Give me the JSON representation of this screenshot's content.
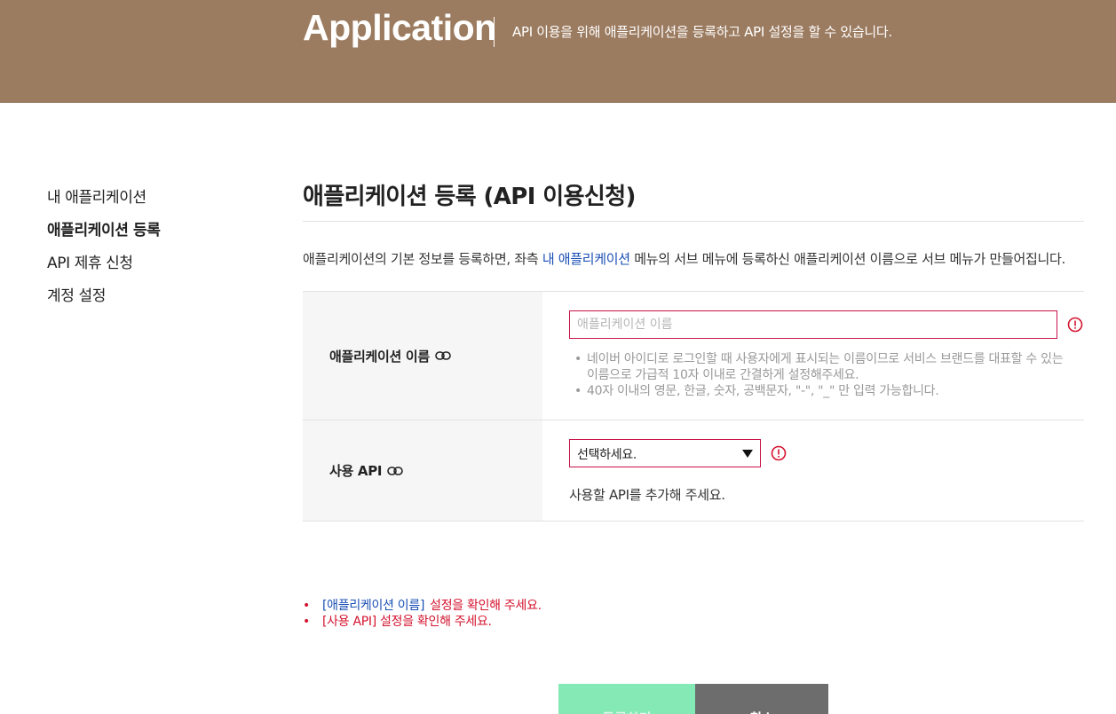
{
  "header": {
    "title": "Application",
    "description": "API 이용을 위해 애플리케이션을 등록하고 API 설정을 할 수 있습니다."
  },
  "sidebar": {
    "items": [
      {
        "label": "내 애플리케이션",
        "active": false
      },
      {
        "label": "애플리케이션 등록",
        "active": true
      },
      {
        "label": "API 제휴 신청",
        "active": false
      },
      {
        "label": "계정 설정",
        "active": false
      }
    ]
  },
  "main": {
    "title": "애플리케이션 등록 (API 이용신청)",
    "intro_before": "애플리케이션의 기본 정보를 등록하면, 좌측 ",
    "intro_link": "내 애플리케이션",
    "intro_after": " 메뉴의 서브 메뉴에 등록하신 애플리케이션 이름으로 서브 메뉴가 만들어집니다."
  },
  "form": {
    "app_name": {
      "label": "애플리케이션 이름",
      "value": "",
      "placeholder": "애플리케이션 이름",
      "hints": [
        "네이버 아이디로 로그인할 때 사용자에게 표시되는 이름이므로 서비스 브랜드를 대표할 수 있는 이름으로 가급적 10자 이내로 간결하게 설정해주세요.",
        "40자 이내의 영문, 한글, 숫자, 공백문자, \"-\", \"_\" 만 입력 가능합니다."
      ]
    },
    "api": {
      "label": "사용 API",
      "selected": "선택하세요.",
      "note": "사용할 API를 추가해 주세요."
    }
  },
  "errors": [
    {
      "field": "[애플리케이션 이름]",
      "message": "설정을 확인해 주세요."
    },
    {
      "field": "",
      "message": "[사용 API]  설정을 확인해 주세요."
    }
  ],
  "buttons": {
    "register": "등록하기",
    "cancel": "취소"
  },
  "colors": {
    "header_bg": "#9c7c61",
    "error": "#d4132e",
    "link": "#1a4fb4",
    "register_button": "#84e9b5",
    "cancel_button": "#6d6d6d"
  },
  "icons": {
    "label_link": "link-icon",
    "field_warning": "exclamation-circle-icon",
    "dropdown": "caret-down-icon"
  }
}
